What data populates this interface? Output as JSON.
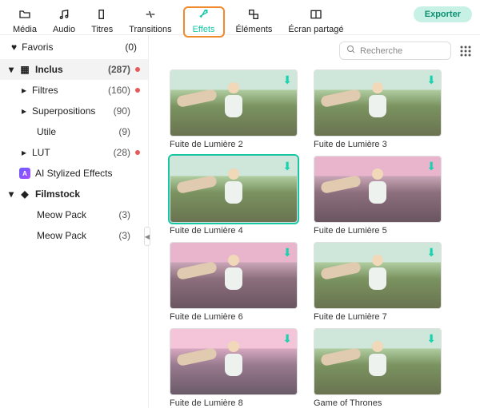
{
  "top": {
    "tabs": [
      {
        "label": "Média"
      },
      {
        "label": "Audio"
      },
      {
        "label": "Titres"
      },
      {
        "label": "Transitions"
      },
      {
        "label": "Effets"
      },
      {
        "label": "Éléments"
      },
      {
        "label": "Écran partagé"
      }
    ],
    "active": 4,
    "export": "Exporter"
  },
  "search": {
    "placeholder": "Recherche"
  },
  "sidebar": {
    "favorites": {
      "label": "Favoris",
      "count": "(0)"
    },
    "items": [
      {
        "label": "Inclus",
        "count": "(287)",
        "dot": true,
        "group": true,
        "selected": true,
        "caret": "down",
        "iconGrid": true
      },
      {
        "label": "Filtres",
        "count": "(160)",
        "dot": true,
        "indent": 1,
        "caret": "right"
      },
      {
        "label": "Superpositions",
        "count": "(90)",
        "dot": false,
        "indent": 1,
        "caret": "right"
      },
      {
        "label": "Utile",
        "count": "(9)",
        "dot": false,
        "indent": 2
      },
      {
        "label": "LUT",
        "count": "(28)",
        "dot": true,
        "indent": 1,
        "caret": "right"
      },
      {
        "label": "AI Stylized Effects",
        "count": "",
        "dot": false,
        "indent": 0,
        "ai": true
      },
      {
        "label": "Filmstock",
        "count": "",
        "dot": false,
        "group": true,
        "caret": "down",
        "diamond": true
      },
      {
        "label": "Meow Pack",
        "count": "(3)",
        "dot": false,
        "indent": 2
      },
      {
        "label": "Meow Pack",
        "count": "(3)",
        "dot": false,
        "indent": 2
      }
    ]
  },
  "effects": [
    {
      "name": "Fuite de Lumière 2",
      "tint": "none"
    },
    {
      "name": "Fuite de Lumière 3",
      "tint": "none"
    },
    {
      "name": "Fuite de Lumière 4",
      "tint": "none",
      "selected": true
    },
    {
      "name": "Fuite de Lumière 5",
      "tint": "pink"
    },
    {
      "name": "Fuite de Lumière 6",
      "tint": "pink"
    },
    {
      "name": "Fuite de Lumière 7",
      "tint": "none"
    },
    {
      "name": "Fuite de Lumière 8",
      "tint": "pink2"
    },
    {
      "name": "Game of Thrones",
      "tint": "none"
    }
  ]
}
